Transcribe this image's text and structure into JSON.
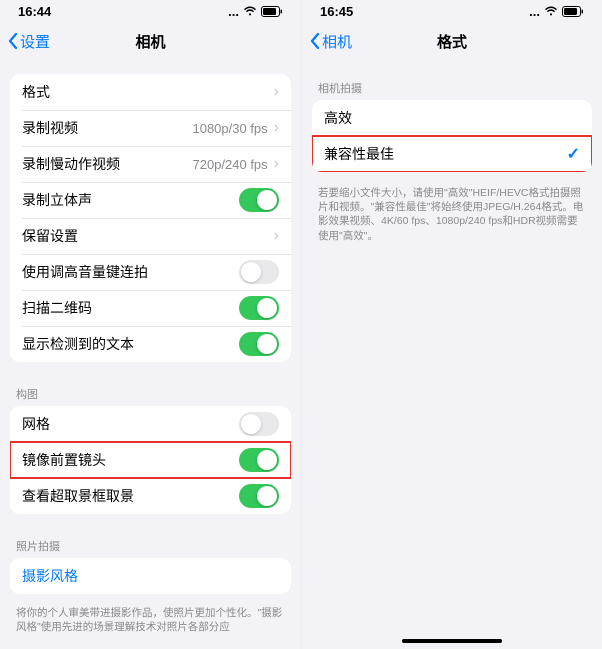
{
  "left": {
    "status": {
      "time": "16:44"
    },
    "nav": {
      "back": "设置",
      "title": "相机"
    },
    "group1": [
      {
        "label": "格式",
        "detail": "",
        "type": "disclosure"
      },
      {
        "label": "录制视频",
        "detail": "1080p/30 fps",
        "type": "disclosure"
      },
      {
        "label": "录制慢动作视频",
        "detail": "720p/240 fps",
        "type": "disclosure"
      },
      {
        "label": "录制立体声",
        "type": "switch",
        "on": true
      },
      {
        "label": "保留设置",
        "detail": "",
        "type": "disclosure"
      },
      {
        "label": "使用调高音量键连拍",
        "type": "switch",
        "on": false
      },
      {
        "label": "扫描二维码",
        "type": "switch",
        "on": true
      },
      {
        "label": "显示检测到的文本",
        "type": "switch",
        "on": true
      }
    ],
    "section2_header": "构图",
    "group2": [
      {
        "label": "网格",
        "type": "switch",
        "on": false
      },
      {
        "label": "镜像前置镜头",
        "type": "switch",
        "on": true,
        "highlighted": true
      },
      {
        "label": "查看超取景框取景",
        "type": "switch",
        "on": true
      }
    ],
    "section3_header": "照片拍摄",
    "group3": [
      {
        "label": "摄影风格",
        "type": "link"
      }
    ],
    "footer3": "将你的个人审美带进摄影作品，使照片更加个性化。\"摄影风格\"使用先进的场景理解技术对照片各部分应"
  },
  "right": {
    "status": {
      "time": "16:45"
    },
    "nav": {
      "back": "相机",
      "title": "格式"
    },
    "section1_header": "相机拍摄",
    "group1": [
      {
        "label": "高效",
        "selected": false
      },
      {
        "label": "兼容性最佳",
        "selected": true,
        "highlighted": true
      }
    ],
    "footer1": "若要缩小文件大小，请使用\"高效\"HEIF/HEVC格式拍摄照片和视频。\"兼容性最佳\"将始终使用JPEG/H.264格式。电影效果视频、4K/60 fps、1080p/240 fps和HDR视频需要使用\"高效\"。"
  }
}
